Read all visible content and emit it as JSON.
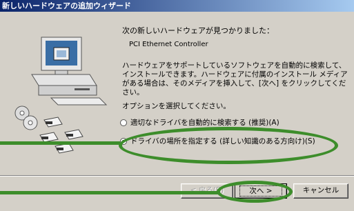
{
  "window": {
    "title": "新しいハードウェアの追加ウィザード"
  },
  "wizard": {
    "heading": "次の新しいハードウェアが見つかりました：",
    "device_name": "PCI Ethernet Controller",
    "description": "ハードウェアをサポートしているソフトウェアを自動的に検索して、インストールできます。ハードウェアに付属のインストール メディアがある場合は、そのメディアを挿入して、[次へ] をクリックしてください。",
    "options_label": "オプションを選択してください。",
    "options": [
      {
        "label": "適切なドライバを自動的に検索する (推奨)(A)",
        "selected": false
      },
      {
        "label": "ドライバの場所を指定する (詳しい知識のある方向け)(S)",
        "selected": true
      }
    ]
  },
  "buttons": {
    "back": "< 戻る(B)",
    "next": "次へ >",
    "cancel": "キャンセル"
  },
  "colors": {
    "highlight": "#3d8d2b",
    "titlebar_start": "#0a246a",
    "dialog_bg": "#d4d0c8"
  }
}
